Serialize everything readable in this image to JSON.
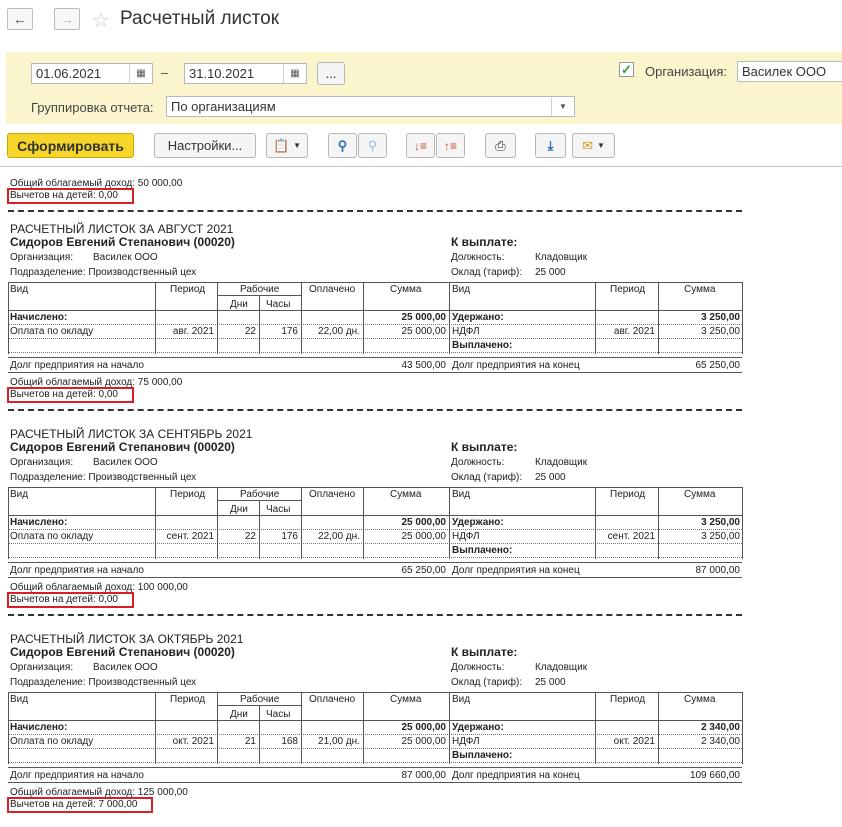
{
  "window": {
    "title": "Расчетный листок"
  },
  "filters": {
    "date_from": "01.06.2021",
    "date_dash": "–",
    "date_to": "31.10.2021",
    "more_label": "...",
    "organization_label": "Организация:",
    "organization_value": "Василек ООО",
    "grouping_label": "Группировка отчета:",
    "grouping_value": "По организациям"
  },
  "toolbar": {
    "generate_label": "Сформировать",
    "settings_label": "Настройки..."
  },
  "report": {
    "top": {
      "income": "Общий облагаемый доход: 50 000,00",
      "children": "Вычетов на детей: 0,00"
    },
    "headers": {
      "vid": "Вид",
      "period": "Период",
      "rabochie": "Рабочие",
      "dni": "Дни",
      "chasy": "Часы",
      "oplacheno": "Оплачено",
      "summa": "Сумма"
    },
    "labels": {
      "k_vyplate": "К выплате:",
      "org": "Организация:",
      "podr": "Подразделение: Производственный цех",
      "dolzh": "Должность:",
      "oklad": "Оклад (тариф):",
      "nachisleno": "Начислено:",
      "uderzhano": "Удержано:",
      "vyplacheno": "Выплачено:",
      "oplata": "Оплата по окладу",
      "ndfl": "НДФЛ",
      "dolg_start": "Долг предприятия на начало",
      "dolg_end": "Долг предприятия на конец"
    },
    "sheets": [
      {
        "title": "РАСЧЕТНЫЙ ЛИСТОК ЗА АВГУСТ 2021",
        "employee": "Сидоров Евгений Степанович (00020)",
        "org": "Василек ООО",
        "position": "Кладовщик",
        "salary": "25 000",
        "accrued_total": "25 000,00",
        "withheld_total": "3 250,00",
        "period": "авг. 2021",
        "days": "22",
        "hours": "176",
        "paid": "22,00 дн.",
        "sum": "25 000,00",
        "ndfl_period": "авг. 2021",
        "ndfl_sum": "3 250,00",
        "debt_start": "43 500,00",
        "debt_end": "65 250,00",
        "income": "Общий облагаемый доход: 75 000,00",
        "children": "Вычетов на детей: 0,00"
      },
      {
        "title": "РАСЧЕТНЫЙ ЛИСТОК ЗА СЕНТЯБРЬ 2021",
        "employee": "Сидоров Евгений Степанович (00020)",
        "org": "Василек ООО",
        "position": "Кладовщик",
        "salary": "25 000",
        "accrued_total": "25 000,00",
        "withheld_total": "3 250,00",
        "period": "сент. 2021",
        "days": "22",
        "hours": "176",
        "paid": "22,00 дн.",
        "sum": "25 000,00",
        "ndfl_period": "сент. 2021",
        "ndfl_sum": "3 250,00",
        "debt_start": "65 250,00",
        "debt_end": "87 000,00",
        "income": "Общий облагаемый доход: 100 000,00",
        "children": "Вычетов на детей: 0,00"
      },
      {
        "title": "РАСЧЕТНЫЙ ЛИСТОК ЗА ОКТЯБРЬ 2021",
        "employee": "Сидоров Евгений Степанович (00020)",
        "org": "Василек ООО",
        "position": "Кладовщик",
        "salary": "25 000",
        "accrued_total": "25 000,00",
        "withheld_total": "2 340,00",
        "period": "окт. 2021",
        "days": "21",
        "hours": "168",
        "paid": "21,00 дн.",
        "sum": "25 000,00",
        "ndfl_period": "окт. 2021",
        "ndfl_sum": "2 340,00",
        "debt_start": "87 000,00",
        "debt_end": "109 660,00",
        "income": "Общий облагаемый доход: 125 000,00",
        "children": "Вычетов на детей: 7 000,00"
      }
    ]
  },
  "colors": {
    "accent": "#f6d52a",
    "panel": "#fbf5ce",
    "highlight": "#d61f26",
    "check": "#2e9d3e"
  }
}
